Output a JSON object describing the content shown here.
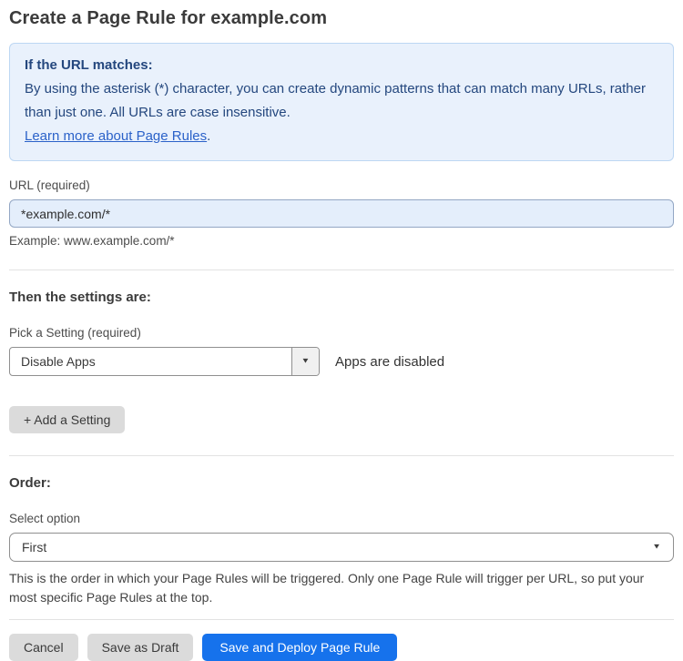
{
  "page": {
    "title": "Create a Page Rule for example.com"
  },
  "info_box": {
    "heading": "If the URL matches:",
    "body": "By using the asterisk (*) character, you can create dynamic patterns that can match many URLs, rather than just one. All URLs are case insensitive.",
    "link_label": "Learn more about Page Rules",
    "link_suffix": "."
  },
  "url_field": {
    "label": "URL (required)",
    "value": "*example.com/*",
    "helper": "Example: www.example.com/*"
  },
  "settings_section": {
    "heading": "Then the settings are:",
    "picker_label": "Pick a Setting (required)",
    "selected_setting": "Disable Apps",
    "setting_status": "Apps are disabled",
    "add_setting_label": "+ Add a Setting"
  },
  "order_section": {
    "heading": "Order:",
    "select_label": "Select option",
    "selected_option": "First",
    "helper": "This is the order in which your Page Rules will be triggered. Only one Page Rule will trigger per URL, so put your most specific Page Rules at the top."
  },
  "footer": {
    "cancel_label": "Cancel",
    "save_draft_label": "Save as Draft",
    "save_deploy_label": "Save and Deploy Page Rule"
  },
  "icons": {
    "caret_down": "▼"
  },
  "colors": {
    "accent_blue": "#1672ec",
    "info_box_bg": "#e9f1fc",
    "info_box_border": "#bdd7f3",
    "info_text": "#24477e",
    "link_blue": "#2b62c9",
    "url_input_bg": "#e4eefb",
    "gray_button_bg": "#dbdbdb"
  }
}
